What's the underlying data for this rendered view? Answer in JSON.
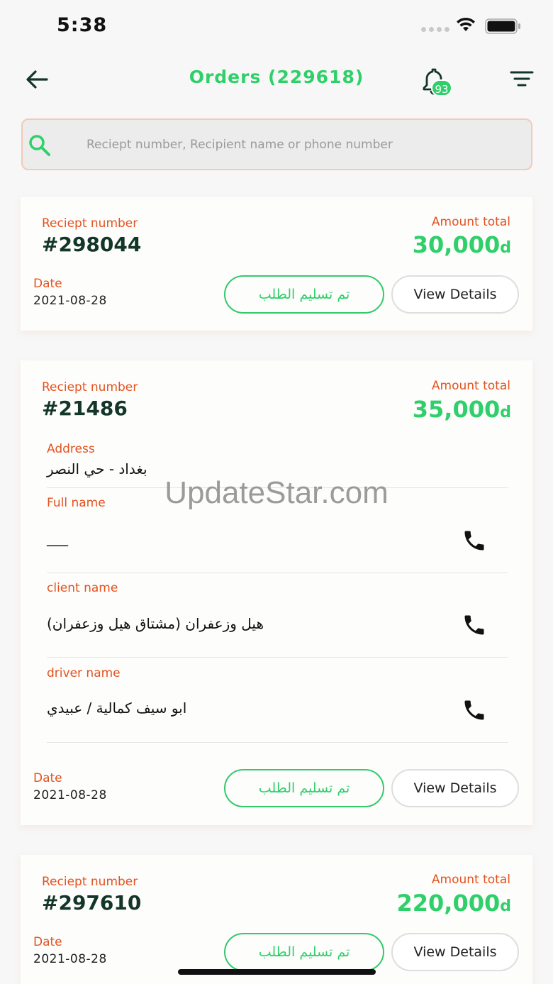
{
  "status_bar": {
    "time": "5:38"
  },
  "header": {
    "title": "Orders (229618)",
    "notification_count": "93"
  },
  "search": {
    "placeholder": "Reciept number, Recipient name or phone number",
    "value": ""
  },
  "labels": {
    "receipt": "Reciept number",
    "amount": "Amount total",
    "date": "Date",
    "address": "Address",
    "full_name": "Full name",
    "client_name": "client name",
    "driver_name": "driver name",
    "status_button": "تم تسليم الطلب",
    "details_button": "View Details",
    "currency": "d"
  },
  "orders": [
    {
      "receipt": "#298044",
      "amount": "30,000",
      "date": "2021-08-28"
    },
    {
      "receipt": "#21486",
      "amount": "35,000",
      "date": "2021-08-28",
      "address": "بغداد - حي النصر",
      "full_name": "___",
      "client_name": "هيل وزعفران (مشتاق هيل وزعفران)",
      "driver_name": "ابو سيف كمالية / عبيدي"
    },
    {
      "receipt": "#297610",
      "amount": "220,000",
      "date": "2021-08-28"
    }
  ],
  "watermark": "UpdateStar.com",
  "colors": {
    "accent": "#2fcf6a",
    "label": "#e4521f",
    "dark": "#14352a"
  }
}
